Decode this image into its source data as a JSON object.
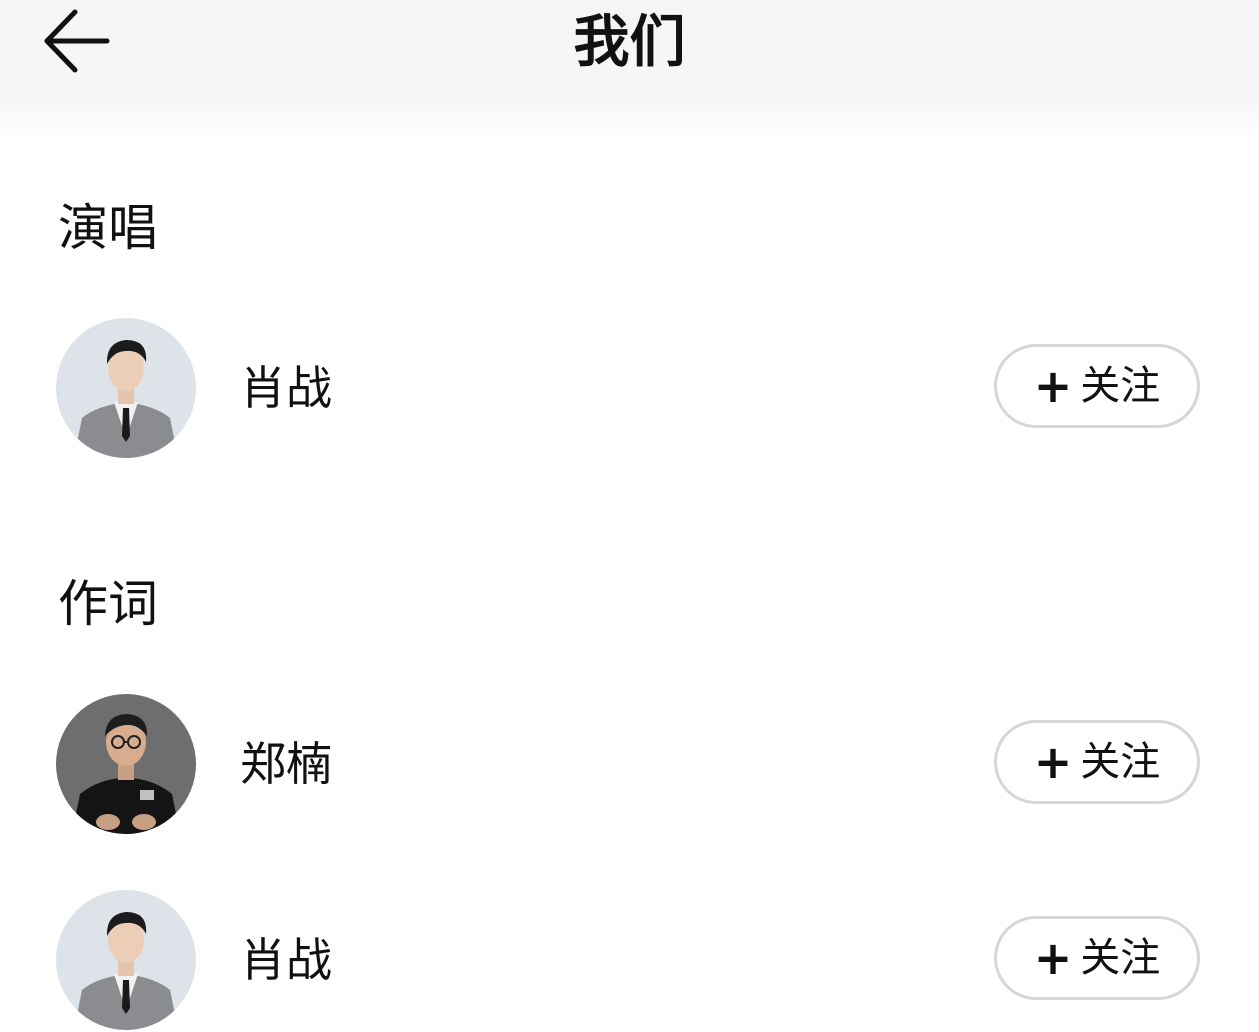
{
  "header": {
    "title": "我们",
    "back_icon": "arrow-left-icon"
  },
  "sections": [
    {
      "title": "演唱",
      "people": [
        {
          "name": "肖战",
          "follow_label": "关注",
          "follow_icon": "+"
        }
      ]
    },
    {
      "title": "作词",
      "people": [
        {
          "name": "郑楠",
          "follow_label": "关注",
          "follow_icon": "+"
        },
        {
          "name": "肖战",
          "follow_label": "关注",
          "follow_icon": "+"
        }
      ]
    }
  ],
  "colors": {
    "header_bg": "#f5f5f5",
    "text": "#111111",
    "button_border": "#d6d6d6"
  }
}
